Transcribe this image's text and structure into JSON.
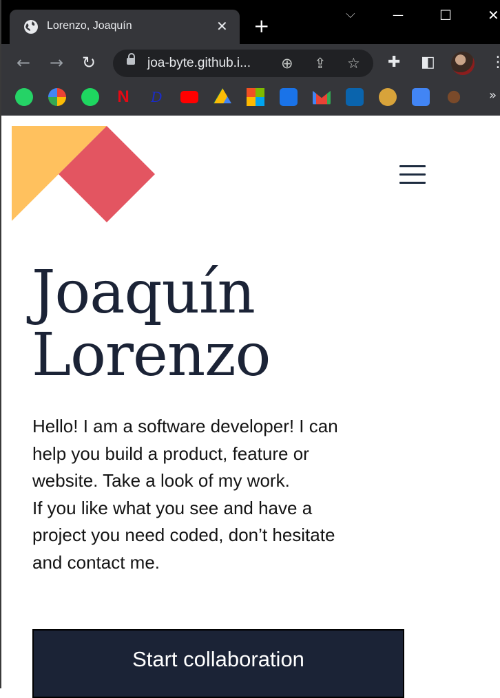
{
  "browser": {
    "tab_title": "Lorenzo, Joaquín",
    "tab_close": "✕",
    "new_tab": "+",
    "window_controls": {
      "dropdown": "⌵",
      "minimize": "—",
      "maximize": "☐",
      "close": "✕"
    },
    "url": "joa-byte.github.i...",
    "bookmarks_overflow": "»",
    "bookmark_icons": [
      "whatsapp-icon",
      "google-icon",
      "spotify-icon",
      "netflix-icon",
      "disney-plus-icon",
      "youtube-icon",
      "google-drive-icon",
      "microsoft-icon",
      "google-contacts-icon",
      "gmail-icon",
      "outlook-icon",
      "bookmark-avatar-icon",
      "google-translate-icon",
      "bookmark-misc-icon"
    ]
  },
  "site": {
    "logo_colors": {
      "yellow": "#FFC15E",
      "red": "#E35561"
    },
    "hero": {
      "first_name": "Joaquín",
      "last_name": "Lorenzo"
    },
    "intro_lines": [
      "Hello! I am a software developer! I can",
      "help you build a product, feature or",
      "website. Take a look of my work.",
      "If you like what you see and have a",
      "project you need coded, don’t hesitate",
      "and contact me."
    ],
    "cta_label": "Start collaboration",
    "accent_dark": "#1B2336"
  }
}
